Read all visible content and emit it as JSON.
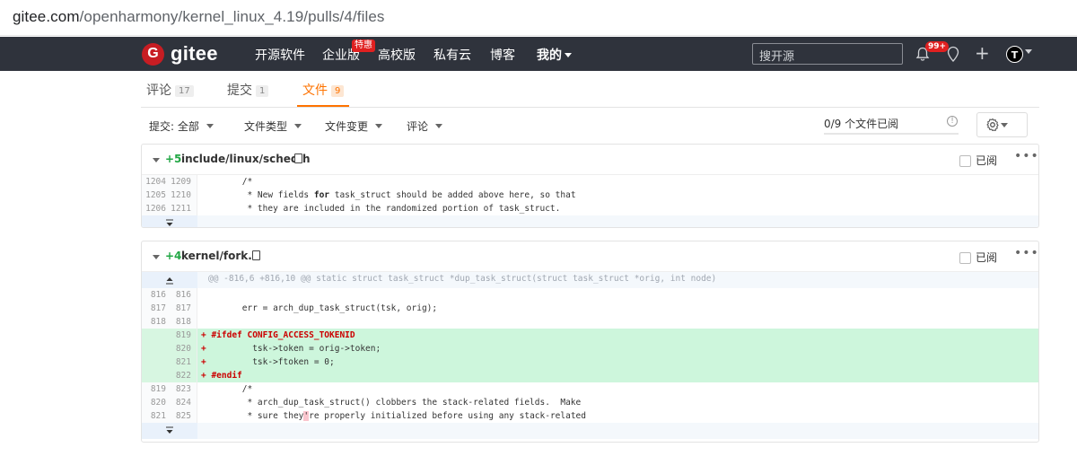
{
  "browser": {
    "url_host": "gitee.com",
    "url_path": "/openharmony/kernel_linux_4.19/pulls/4/files"
  },
  "navbar": {
    "logo_text": "gitee",
    "items": [
      "开源软件",
      "企业版",
      "高校版",
      "私有云",
      "博客",
      "我的"
    ],
    "enterprise_badge": "特惠",
    "search_placeholder": "搜开源",
    "notification_count": "99+",
    "avatar_letter": "T"
  },
  "tabs": [
    {
      "label": "评论",
      "count": "17"
    },
    {
      "label": "提交",
      "count": "1"
    },
    {
      "label": "文件",
      "count": "9",
      "active": true
    }
  ],
  "filters": {
    "commit": "提交: 全部",
    "file_type": "文件类型",
    "file_change": "文件变更",
    "comment": "评论",
    "progress_label": "0/9 个文件已阅",
    "progress_fraction": 0
  },
  "files": [
    {
      "additions": "+5",
      "path": "include/linux/sched.h",
      "viewed_label": "已阅",
      "more": "•••",
      "lines": [
        {
          "old": "1204",
          "new": "1209",
          "text": "        /*"
        },
        {
          "old": "1205",
          "new": "1210",
          "pre": "         * New fields ",
          "kw": "for",
          "post": " task_struct should be added above here, so that"
        },
        {
          "old": "1206",
          "new": "1211",
          "text": "         * they are included in the randomized portion of task_struct."
        }
      ]
    },
    {
      "additions": "+4",
      "path": "kernel/fork.c",
      "viewed_label": "已阅",
      "more": "•••",
      "hunk": "@@ -816,6 +816,10 @@ static struct task_struct *dup_task_struct(struct task_struct *orig, int node)",
      "lines": [
        {
          "old": "816",
          "new": "816",
          "text": ""
        },
        {
          "old": "817",
          "new": "817",
          "text": "        err = arch_dup_task_struct(tsk, orig);"
        },
        {
          "old": "818",
          "new": "818",
          "text": ""
        },
        {
          "old": "",
          "new": "819",
          "add": true,
          "text": "+ #ifdef CONFIG_ACCESS_TOKENID"
        },
        {
          "old": "",
          "new": "820",
          "add": true,
          "text": "+         tsk->token = orig->token;"
        },
        {
          "old": "",
          "new": "821",
          "add": true,
          "text": "+         tsk->ftoken = 0;"
        },
        {
          "old": "",
          "new": "822",
          "add": true,
          "text": "+ #endif"
        },
        {
          "old": "819",
          "new": "823",
          "text": "        /*"
        },
        {
          "old": "820",
          "new": "824",
          "text": "         * arch_dup_task_struct() clobbers the stack-related fields.  Make"
        },
        {
          "old": "821",
          "new": "825",
          "pre": "         * sure they",
          "hl": "'",
          "post": "re properly initialized before using any stack-related"
        }
      ]
    }
  ]
}
